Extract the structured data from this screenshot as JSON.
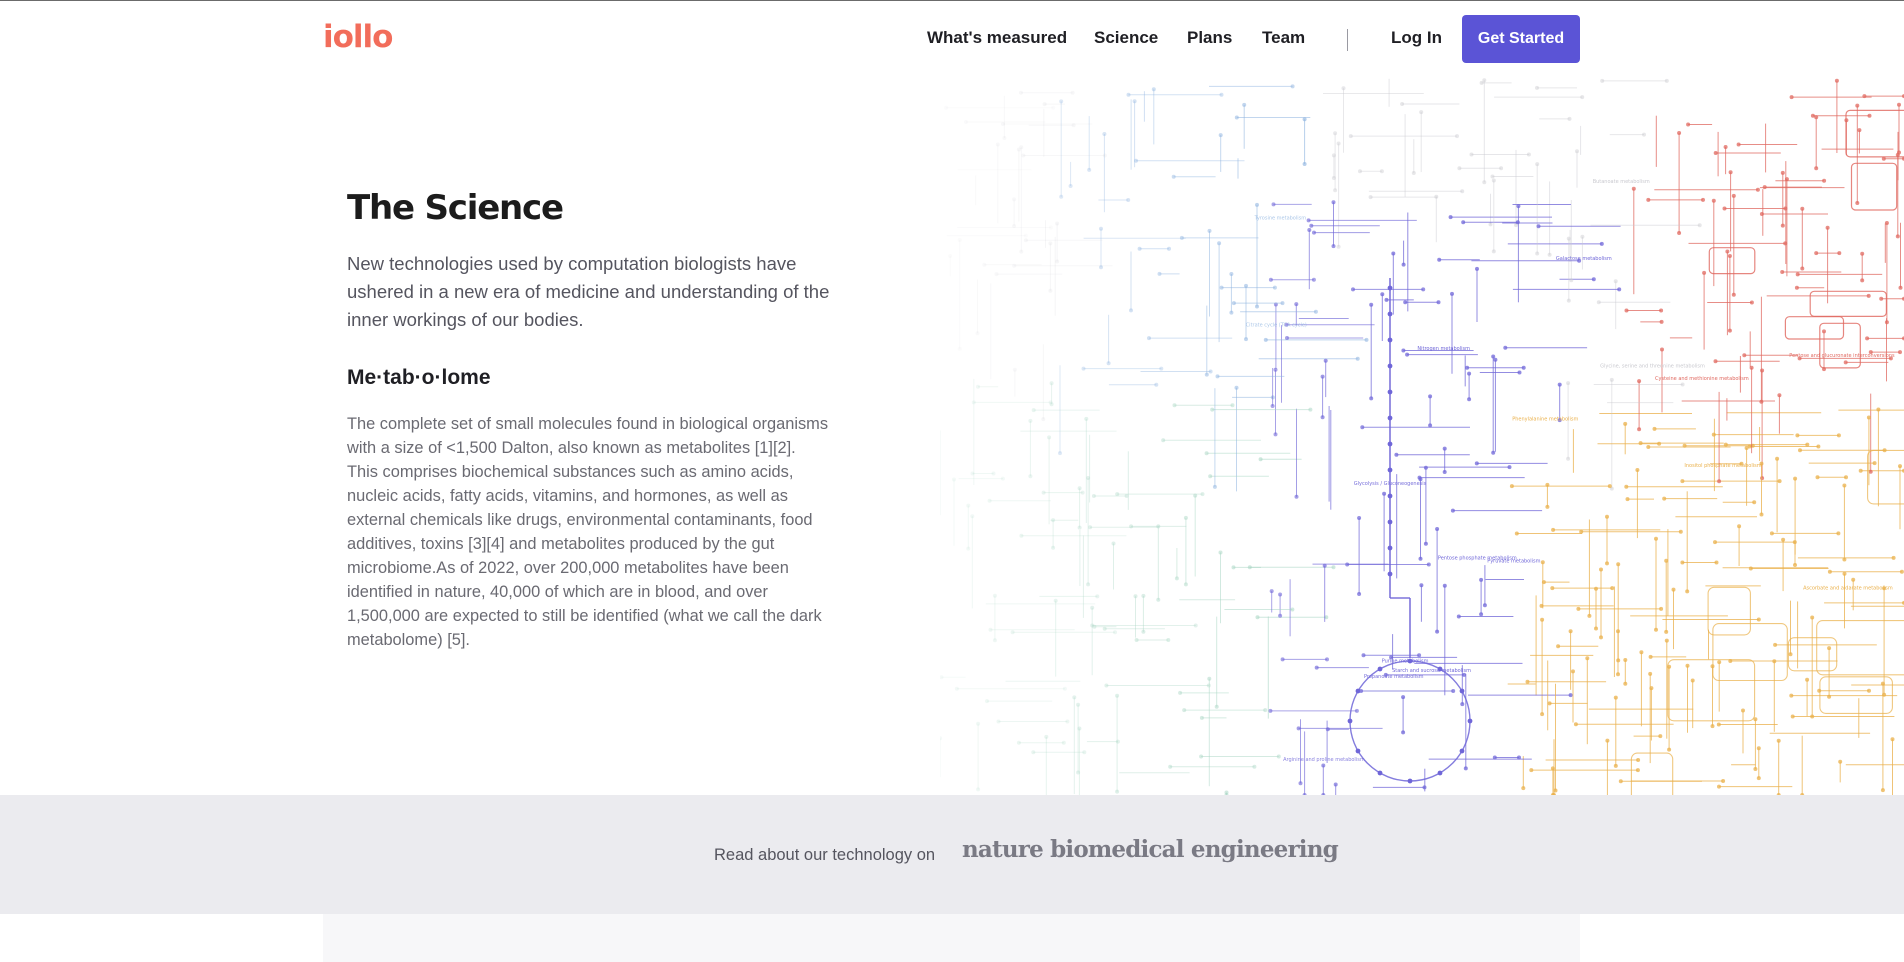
{
  "brand": {
    "logo": "iollo",
    "accent": "#f26d5b",
    "primary": "#5b54d6"
  },
  "nav": {
    "items": [
      "What's measured",
      "Science",
      "Plans",
      "Team"
    ],
    "login": "Log In",
    "cta": "Get Started"
  },
  "hero": {
    "title": "The Science",
    "lead": "New technologies used by computation biologists have ushered in a new era of medicine and understanding of the inner workings of our bodies.",
    "subhead": "Me·tab·o·lome",
    "body": "The complete set of small molecules found in biological organisms with a size of <1,500 Dalton, also known as metabolites [1][2]. This comprises biochemical substances such as amino acids, nucleic acids, fatty acids, vitamins, and hormones, as well as external chemicals like drugs, environmental contaminants, food additives, toxins [3][4] and metabolites produced by the gut microbiome.As of 2022, over 200,000 metabolites have been identified in nature, 40,000 of which are in blood, and over 1,500,000 are expected to still be identified (what we call the dark metabolome) [5]."
  },
  "band": {
    "text": "Read about our technology on",
    "publication": "nature biomedical engineering"
  },
  "map": {
    "colors": {
      "blue": "#8fb4e0",
      "purple": "#6f66d8",
      "red": "#e0685f",
      "orange": "#eab04a",
      "teal": "#a9d6c4",
      "grey": "#c9c9cf"
    },
    "labels": [
      "Pentose and glucuronate interconversions",
      "Tyrosine metabolism",
      "Glycolysis / Gluconeogenesis",
      "Citrate cycle (TCA cycle)",
      "Pyruvate metabolism",
      "Starch and sucrose metabolism",
      "Inositol phosphate metabolism",
      "Galactose metabolism",
      "Pentose phosphate metabolism",
      "Ascorbate and aldarate metabolism",
      "Arginine and proline metabolism",
      "Propanoate metabolism",
      "Butanoate metabolism",
      "Nitrogen metabolism",
      "Glycine, serine and threonine metabolism",
      "Cysteine and methionine metabolism",
      "Purine metabolism",
      "Phenylalanine metabolism"
    ]
  }
}
